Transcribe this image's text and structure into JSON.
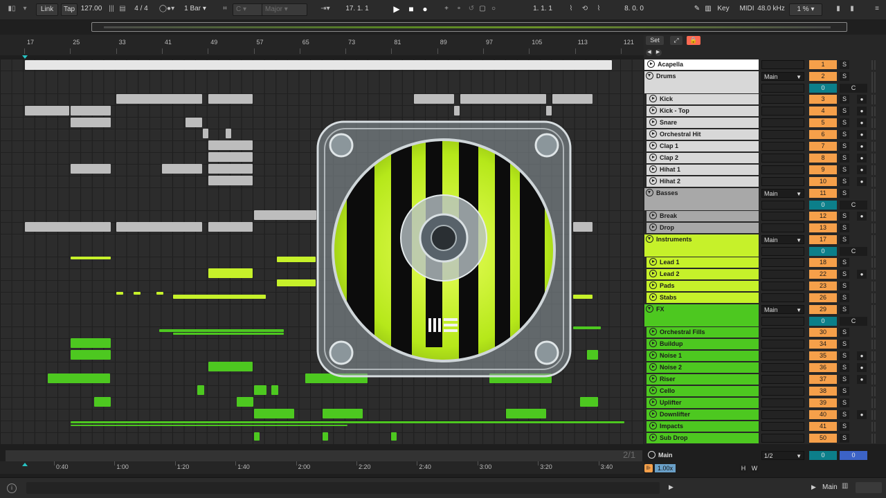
{
  "transport": {
    "link": "Link",
    "tap": "Tap",
    "tempo": "127.00",
    "time_signature": "4 / 4",
    "quantize": "1 Bar",
    "key": "C",
    "scale": "Major",
    "position": "17.  1.  1",
    "loop_start": "1.  1.  1",
    "loop_length": "8.  0.  0",
    "key_label": "Key",
    "midi_label": "MIDI",
    "sample_rate": "48.0 kHz",
    "cpu": "1 %"
  },
  "ruler": {
    "bars": [
      "17",
      "25",
      "33",
      "41",
      "49",
      "57",
      "65",
      "73",
      "81",
      "89",
      "97",
      "105",
      "113",
      "121"
    ]
  },
  "timeline": {
    "times": [
      "0:40",
      "1:00",
      "1:20",
      "1:40",
      "2:00",
      "2:20",
      "2:40",
      "3:00",
      "3:20",
      "3:40"
    ],
    "zoom": "2/1"
  },
  "panel": {
    "set": "Set",
    "expand_icon": "expand-icon",
    "lock_icon": "lock-icon"
  },
  "tracks": [
    {
      "name": "Acapella",
      "color": "#ffffff",
      "type": "audio",
      "h": 17,
      "num": "1"
    },
    {
      "name": "Drums",
      "color": "#d8d8d8",
      "type": "group",
      "h": 33,
      "num": "2",
      "routing": "Main",
      "sub": "0",
      "c": "C"
    },
    {
      "name": "Kick",
      "color": "#d8d8d8",
      "type": "child",
      "h": 17,
      "num": "3",
      "arm": true
    },
    {
      "name": "Kick - Top",
      "color": "#d8d8d8",
      "type": "child",
      "h": 17,
      "num": "4",
      "arm": true
    },
    {
      "name": "Snare",
      "color": "#d8d8d8",
      "type": "child",
      "h": 17,
      "num": "5",
      "arm": true
    },
    {
      "name": "Orchestral Hit",
      "color": "#d8d8d8",
      "type": "child",
      "h": 17,
      "num": "6",
      "arm": true
    },
    {
      "name": "Clap 1",
      "color": "#d8d8d8",
      "type": "child",
      "h": 17,
      "num": "7",
      "arm": true
    },
    {
      "name": "Clap 2",
      "color": "#d8d8d8",
      "type": "child",
      "h": 17,
      "num": "8",
      "arm": true
    },
    {
      "name": "Hihat 1",
      "color": "#d8d8d8",
      "type": "child",
      "h": 17,
      "num": "9",
      "arm": true
    },
    {
      "name": "Hihat 2",
      "color": "#d8d8d8",
      "type": "child",
      "h": 17,
      "num": "10",
      "arm": true
    },
    {
      "name": "Basses",
      "color": "#a8a8a8",
      "type": "group",
      "h": 33,
      "num": "11",
      "routing": "Main",
      "sub": "0",
      "c": "C"
    },
    {
      "name": "Break",
      "color": "#a8a8a8",
      "type": "child",
      "h": 17,
      "num": "12",
      "arm": true
    },
    {
      "name": "Drop",
      "color": "#a8a8a8",
      "type": "child",
      "h": 17,
      "num": "13",
      "arm": false
    },
    {
      "name": "Instruments",
      "color": "#c6f12a",
      "type": "group",
      "h": 33,
      "num": "17",
      "routing": "Main",
      "sub": "0",
      "c": "C"
    },
    {
      "name": "Lead 1",
      "color": "#c6f12a",
      "type": "child",
      "h": 17,
      "num": "18",
      "arm": false
    },
    {
      "name": "Lead 2",
      "color": "#c6f12a",
      "type": "child",
      "h": 17,
      "num": "22",
      "arm": true
    },
    {
      "name": "Pads",
      "color": "#c6f12a",
      "type": "child",
      "h": 17,
      "num": "23",
      "arm": false
    },
    {
      "name": "Stabs",
      "color": "#c6f12a",
      "type": "child",
      "h": 17,
      "num": "26",
      "arm": false
    },
    {
      "name": "FX",
      "color": "#4dc820",
      "type": "group",
      "h": 33,
      "num": "29",
      "routing": "Main",
      "sub": "0",
      "c": "C"
    },
    {
      "name": "Orchestral Fills",
      "color": "#4dc820",
      "type": "child",
      "h": 17,
      "num": "30",
      "arm": false
    },
    {
      "name": "Buildup",
      "color": "#4dc820",
      "type": "child",
      "h": 17,
      "num": "34",
      "arm": false
    },
    {
      "name": "Noise 1",
      "color": "#4dc820",
      "type": "child",
      "h": 17,
      "num": "35",
      "arm": true
    },
    {
      "name": "Noise 2",
      "color": "#4dc820",
      "type": "child",
      "h": 17,
      "num": "36",
      "arm": true
    },
    {
      "name": "Riser",
      "color": "#4dc820",
      "type": "child",
      "h": 17,
      "num": "37",
      "arm": true
    },
    {
      "name": "Cello",
      "color": "#4dc820",
      "type": "child",
      "h": 17,
      "num": "38",
      "arm": false
    },
    {
      "name": "Uplifter",
      "color": "#4dc820",
      "type": "child",
      "h": 17,
      "num": "39",
      "arm": false
    },
    {
      "name": "Downlifter",
      "color": "#4dc820",
      "type": "child",
      "h": 17,
      "num": "40",
      "arm": true
    },
    {
      "name": "Impacts",
      "color": "#4dc820",
      "type": "child",
      "h": 17,
      "num": "41",
      "arm": false
    },
    {
      "name": "Sub Drop",
      "color": "#4dc820",
      "type": "child",
      "h": 17,
      "num": "50",
      "arm": false
    }
  ],
  "main_track": {
    "name": "Main",
    "routing": "1/2",
    "vol": "0",
    "pan": "0"
  },
  "bottom": {
    "speed": "1.00x",
    "h": "H",
    "w": "W",
    "main": "Main"
  },
  "solo_label": "S",
  "colors": {
    "white": "#e6e6e6",
    "grey": "#bdbdbd",
    "lime": "#c6f12a",
    "green": "#4dc820"
  }
}
